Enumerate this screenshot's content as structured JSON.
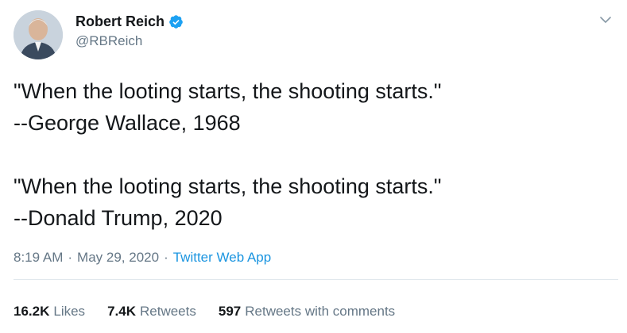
{
  "author": {
    "display_name": "Robert Reich",
    "handle": "@RBReich",
    "verified": true
  },
  "tweet": {
    "text": "\"When the looting starts, the shooting starts.\"\n--George Wallace, 1968\n\n\"When the looting starts, the shooting starts.\"\n--Donald Trump, 2020"
  },
  "meta": {
    "time": "8:19 AM",
    "separator": "·",
    "date": "May 29, 2020",
    "source": "Twitter Web App"
  },
  "stats": {
    "likes_count": "16.2K",
    "likes_label": "Likes",
    "retweets_count": "7.4K",
    "retweets_label": "Retweets",
    "quotes_count": "597",
    "quotes_label": "Retweets with comments"
  },
  "colors": {
    "link": "#1b95e0",
    "secondary_text": "#657786",
    "primary_text": "#14171a",
    "verified": "#1da1f2"
  },
  "icons": {
    "verified": "verified-badge-icon",
    "menu": "chevron-down-icon"
  }
}
